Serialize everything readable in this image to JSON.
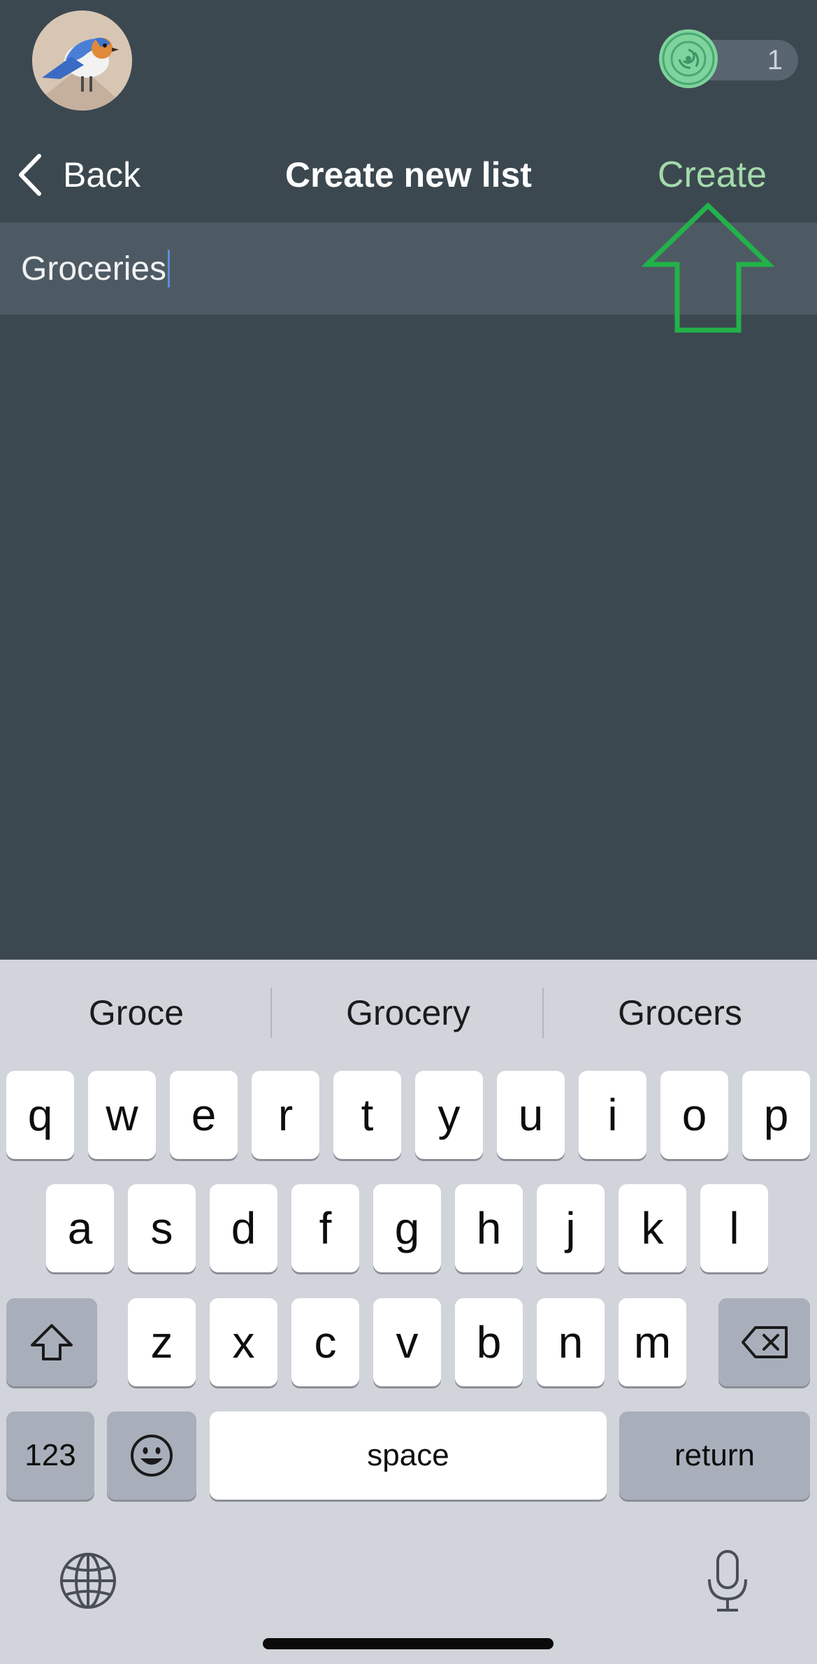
{
  "header": {
    "coin_count": "1"
  },
  "nav": {
    "back_label": "Back",
    "title": "Create new list",
    "create_label": "Create"
  },
  "list_name_input": {
    "value": "Groceries"
  },
  "keyboard": {
    "suggestions": [
      "Groce",
      "Grocery",
      "Grocers"
    ],
    "row1": [
      "q",
      "w",
      "e",
      "r",
      "t",
      "y",
      "u",
      "i",
      "o",
      "p"
    ],
    "row2": [
      "a",
      "s",
      "d",
      "f",
      "g",
      "h",
      "j",
      "k",
      "l"
    ],
    "row3": [
      "z",
      "x",
      "c",
      "v",
      "b",
      "n",
      "m"
    ],
    "numbers_label": "123",
    "space_label": "space",
    "return_label": "return"
  },
  "colors": {
    "background": "#3c4850",
    "input_row": "#4e5a63",
    "create_text": "#a3dbab",
    "arrow_outline": "#22b24a",
    "keyboard_bg": "#d1d4da"
  },
  "icons": {
    "avatar": "bird-avatar-icon",
    "coin": "coin-icon",
    "back": "chevron-left-icon",
    "shift": "shift-icon",
    "delete": "backspace-icon",
    "emoji": "emoji-icon",
    "globe": "globe-icon",
    "mic": "microphone-icon",
    "arrow": "up-arrow-annotation-icon"
  }
}
